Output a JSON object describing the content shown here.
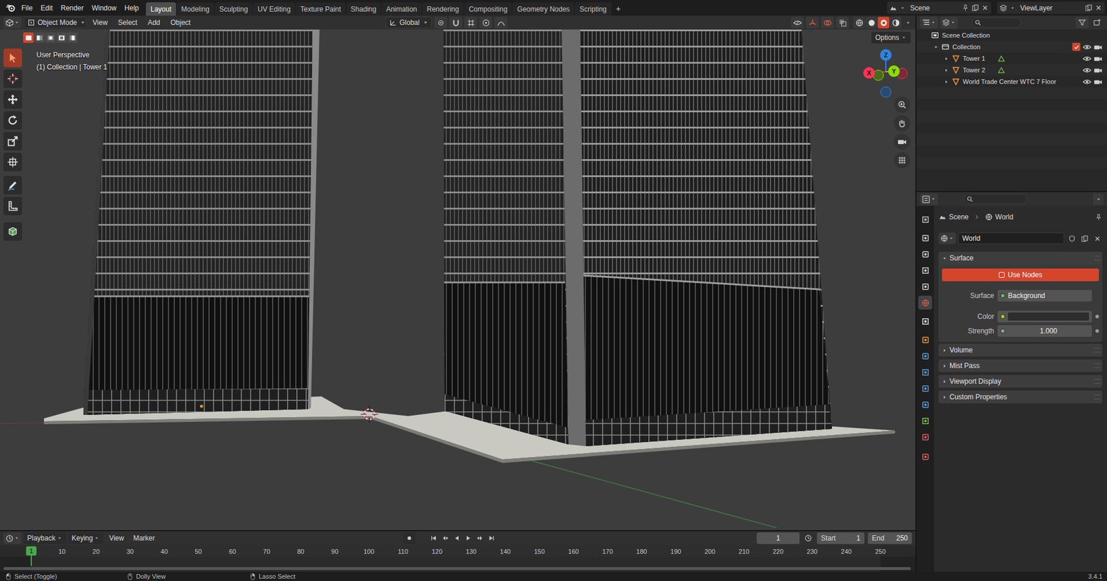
{
  "menu": {
    "items": [
      "File",
      "Edit",
      "Render",
      "Window",
      "Help"
    ]
  },
  "workspaces": [
    {
      "label": "Layout",
      "selected": true
    },
    {
      "label": "Modeling",
      "selected": false
    },
    {
      "label": "Sculpting",
      "selected": false
    },
    {
      "label": "UV Editing",
      "selected": false
    },
    {
      "label": "Texture Paint",
      "selected": false
    },
    {
      "label": "Shading",
      "selected": false
    },
    {
      "label": "Animation",
      "selected": false
    },
    {
      "label": "Rendering",
      "selected": false
    },
    {
      "label": "Compositing",
      "selected": false
    },
    {
      "label": "Geometry Nodes",
      "selected": false
    },
    {
      "label": "Scripting",
      "selected": false
    }
  ],
  "add_workspace": "+",
  "scene": "Scene",
  "view_layer": "ViewLayer",
  "viewport": {
    "mode": "Object Mode",
    "menus": [
      "View",
      "Select",
      "Add",
      "Object"
    ],
    "orientation": "Global",
    "options": "Options",
    "view_name": "User Perspective",
    "context": "(1) Collection | Tower 1",
    "select_modes": [
      {
        "selected": true
      },
      {
        "selected": false
      },
      {
        "selected": false
      },
      {
        "selected": false
      },
      {
        "selected": false
      }
    ],
    "shading": [
      {
        "selected": false
      },
      {
        "selected": false
      },
      {
        "selected": true
      },
      {
        "selected": false
      }
    ],
    "tools": [
      {
        "selected": true
      },
      {
        "selected": false
      },
      {
        "selected": false
      },
      {
        "selected": false
      },
      {
        "selected": false
      },
      {
        "selected": false
      },
      {
        "selected": false
      },
      {
        "selected": false
      },
      {
        "selected": false
      }
    ],
    "gizmo": {
      "x": "X",
      "y": "Y",
      "z": "Z"
    }
  },
  "outliner": {
    "root": "Scene Collection",
    "collection": {
      "label": "Collection",
      "expanded": true,
      "checked": true,
      "visible": true,
      "renderable": true
    },
    "objects": [
      {
        "label": "Tower 1",
        "expanded": false,
        "data_icon": true,
        "visible": true,
        "renderable": true
      },
      {
        "label": "Tower 2",
        "expanded": false,
        "data_icon": true,
        "visible": true,
        "renderable": true
      },
      {
        "label": "World Trade Center WTC 7 Floor",
        "expanded": false,
        "data_icon": false,
        "visible": true,
        "renderable": true
      }
    ]
  },
  "properties": {
    "tabs": [
      {
        "selected": false
      },
      {
        "selected": false
      },
      {
        "selected": false
      },
      {
        "selected": false
      },
      {
        "selected": false
      },
      {
        "selected": true
      },
      {
        "selected": false
      },
      {
        "selected": false
      },
      {
        "selected": false
      },
      {
        "selected": false
      },
      {
        "selected": false
      },
      {
        "selected": false
      },
      {
        "selected": false
      },
      {
        "selected": false
      },
      {
        "selected": false
      }
    ],
    "breadcrumb": [
      "Scene",
      "World"
    ],
    "world": "World",
    "panels": [
      {
        "label": "Surface",
        "expanded": true,
        "button": "Use Nodes",
        "fields": [
          {
            "kind": "shader",
            "label": "Surface",
            "value": "Background"
          },
          {
            "kind": "color",
            "label": "Color",
            "color": "#2d2d2d"
          },
          {
            "kind": "number",
            "label": "Strength",
            "value": "1.000"
          }
        ]
      },
      {
        "label": "Volume",
        "expanded": false,
        "fields": []
      },
      {
        "label": "Mist Pass",
        "expanded": false,
        "fields": []
      },
      {
        "label": "Viewport Display",
        "expanded": false,
        "fields": []
      },
      {
        "label": "Custom Properties",
        "expanded": false,
        "fields": []
      }
    ]
  },
  "timeline": {
    "menus": [
      "Playback",
      "Keying",
      "View",
      "Marker"
    ],
    "frame": "1",
    "start_label": "Start",
    "start": "1",
    "end_label": "End",
    "end": "250",
    "playhead": "1",
    "ticks": [
      "10",
      "20",
      "30",
      "40",
      "50",
      "60",
      "70",
      "80",
      "90",
      "100",
      "110",
      "120",
      "130",
      "140",
      "150",
      "160",
      "170",
      "180",
      "190",
      "200",
      "210",
      "220",
      "230",
      "240",
      "250"
    ]
  },
  "status": {
    "hints": [
      "Select (Toggle)",
      "Dolly View",
      "Lasso Select"
    ],
    "version": "3.4.1"
  }
}
